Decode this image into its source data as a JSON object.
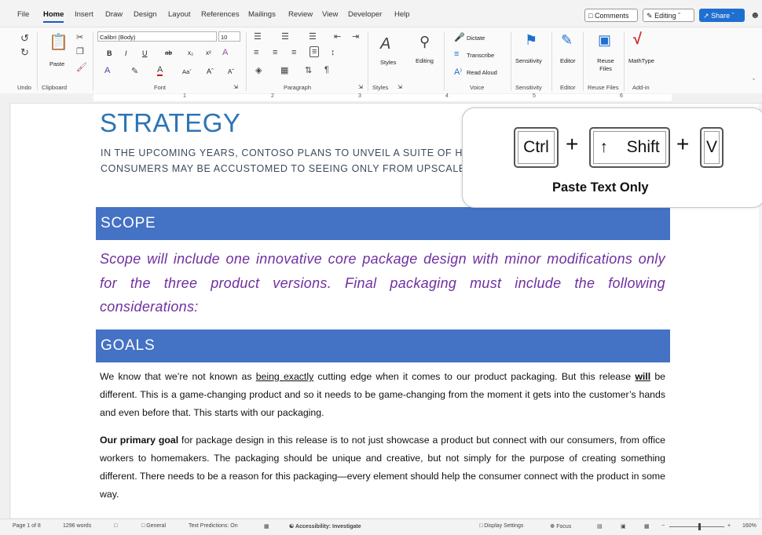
{
  "menu": {
    "tabs": [
      "File",
      "Home",
      "Insert",
      "Draw",
      "Design",
      "Layout",
      "References",
      "Mailings",
      "Review",
      "View",
      "Developer",
      "Help"
    ],
    "active_tab": "Home",
    "comments_label": "Comments",
    "editing_label": "Editing",
    "share_label": "Share"
  },
  "ribbon": {
    "undo_label": "Undo",
    "clipboard_label": "Clipboard",
    "paste_label": "Paste",
    "font_name": "Calibri (Body)",
    "font_size": "10",
    "font_label": "Font",
    "paragraph_label": "Paragraph",
    "styles_label": "Styles",
    "styles_group_label": "Styles",
    "editing_label": "Editing",
    "dictate_label": "Dictate",
    "transcribe_label": "Transcribe",
    "read_aloud_label": "Read Aloud",
    "voice_label": "Voice",
    "sensitivity_label": "Sensitivity",
    "sensitivity_group_label": "Sensitivity",
    "editor_label": "Editor",
    "editor_group_label": "Editor",
    "reuse_files_label": "Reuse Files",
    "reuse_files_group_label": "Reuse Files",
    "mathtype_label": "MathType",
    "addin_label": "Add-in"
  },
  "ruler": {
    "numbers": [
      "1",
      "2",
      "3",
      "4",
      "5",
      "6"
    ]
  },
  "document": {
    "heading": "STRATEGY",
    "intro_line1": "IN THE UPCOMING YEARS, CONTOSO PLANS TO UNVEIL A SUITE OF HIGH",
    "intro_line2": "CONSUMERS MAY BE ACCUSTOMED TO SEEING ONLY FROM UPSCALE EL",
    "scope_heading": "SCOPE",
    "scope_text": "Scope will include one innovative core package design with minor modifications only for the three product versions. Final packaging must include the following considerations:",
    "goals_heading": "GOALS",
    "p1_a": "We know that we’re not known as ",
    "p1_b": "being exactly",
    "p1_c": " cutting edge when it comes to our product packaging. But this release ",
    "p1_d": "will",
    "p1_e": " be different. This is a game-changing product and so it needs to be game-changing from the moment it gets into the customer’s hands and even before that. This starts with our packaging.",
    "p2_a": "Our primary goal",
    "p2_b": " for package design in this release is to not just showcase a product but connect with our consumers, from office workers to homemakers. The packaging should be unique and creative, but not simply for the purpose of creating something different. There needs to be a reason for this packaging—every element should help the consumer connect with the product in some way."
  },
  "overlay": {
    "key1": "Ctrl",
    "key2_arrow": "↑",
    "key2": "Shift",
    "key3": "V",
    "plus": "+",
    "label": "Paste Text Only"
  },
  "status": {
    "page": "Page 1 of 8",
    "words": "1296 words",
    "general": "General",
    "predictions": "Text Predictions: On",
    "accessibility": "Accessibility: Investigate",
    "display": "Display Settings",
    "focus": "Focus",
    "zoom": "160%"
  }
}
